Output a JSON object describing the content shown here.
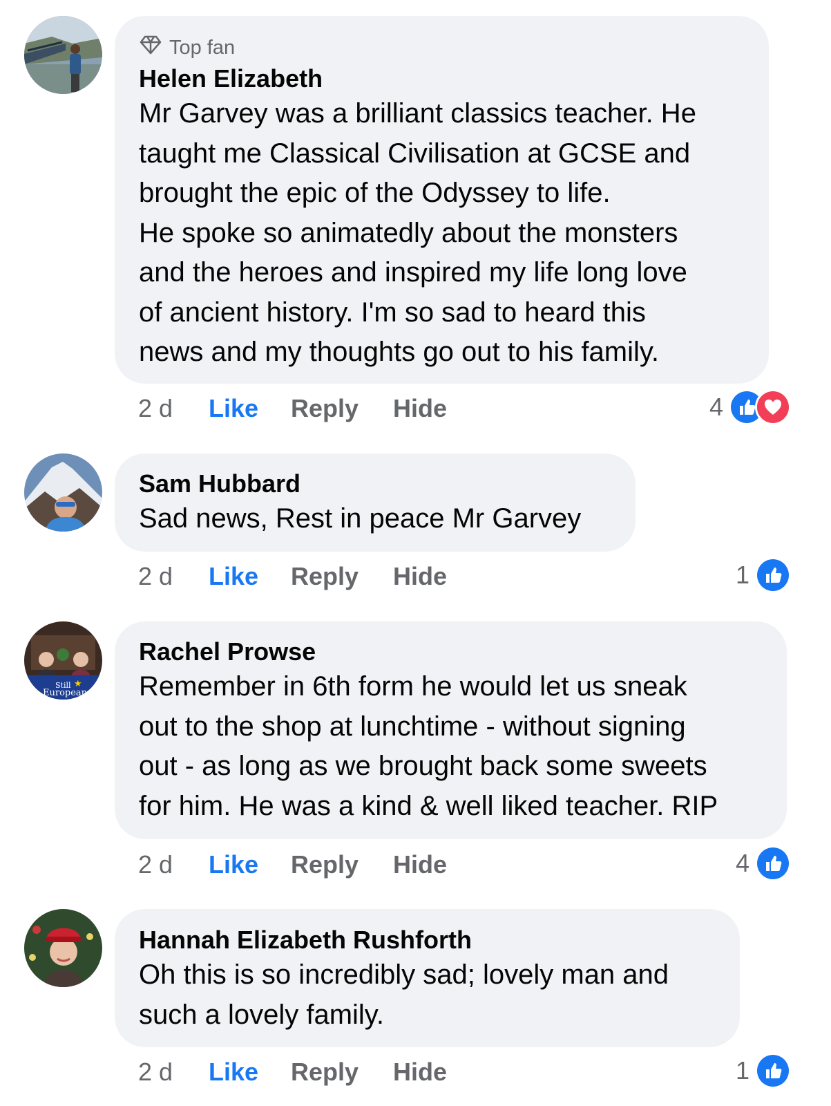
{
  "colors": {
    "like_blue": "#1877f2",
    "love_red": "#f33e58",
    "bubble_bg": "#f0f2f5",
    "muted": "#65676b"
  },
  "comments": [
    {
      "badge": "Top fan",
      "badge_icon": "diamond-icon",
      "author": "Helen Elizabeth",
      "lines": [
        "Mr Garvey was a brilliant classics teacher. He",
        "taught me Classical Civilisation at GCSE and",
        "brought the epic of the Odyssey to life.",
        "He spoke so animatedly about the monsters",
        "and the heroes and inspired my life long love",
        "of ancient history. I'm so sad to heard this",
        "news and my thoughts go out to his family."
      ],
      "time": "2 d",
      "like": "Like",
      "reply": "Reply",
      "hide": "Hide",
      "reaction_count": "4",
      "reactions": [
        "like-reaction-icon",
        "love-reaction-icon"
      ]
    },
    {
      "author": "Sam Hubbard",
      "lines": [
        "Sad news, Rest in peace Mr Garvey"
      ],
      "time": "2 d",
      "like": "Like",
      "reply": "Reply",
      "hide": "Hide",
      "reaction_count": "1",
      "reactions": [
        "like-reaction-icon"
      ]
    },
    {
      "author": "Rachel Prowse",
      "avatar_text": "Still European",
      "lines": [
        "Remember in 6th form he would let us sneak",
        "out to the shop at lunchtime - without signing",
        "out - as long as we brought back some sweets",
        "for him. He was a kind & well liked teacher. RIP"
      ],
      "time": "2 d",
      "like": "Like",
      "reply": "Reply",
      "hide": "Hide",
      "reaction_count": "4",
      "reactions": [
        "like-reaction-icon"
      ]
    },
    {
      "author": "Hannah Elizabeth Rushforth",
      "lines": [
        "Oh this is so incredibly sad; lovely man and",
        "such a lovely family."
      ],
      "time": "2 d",
      "like": "Like",
      "reply": "Reply",
      "hide": "Hide",
      "reaction_count": "1",
      "reactions": [
        "like-reaction-icon"
      ]
    }
  ]
}
